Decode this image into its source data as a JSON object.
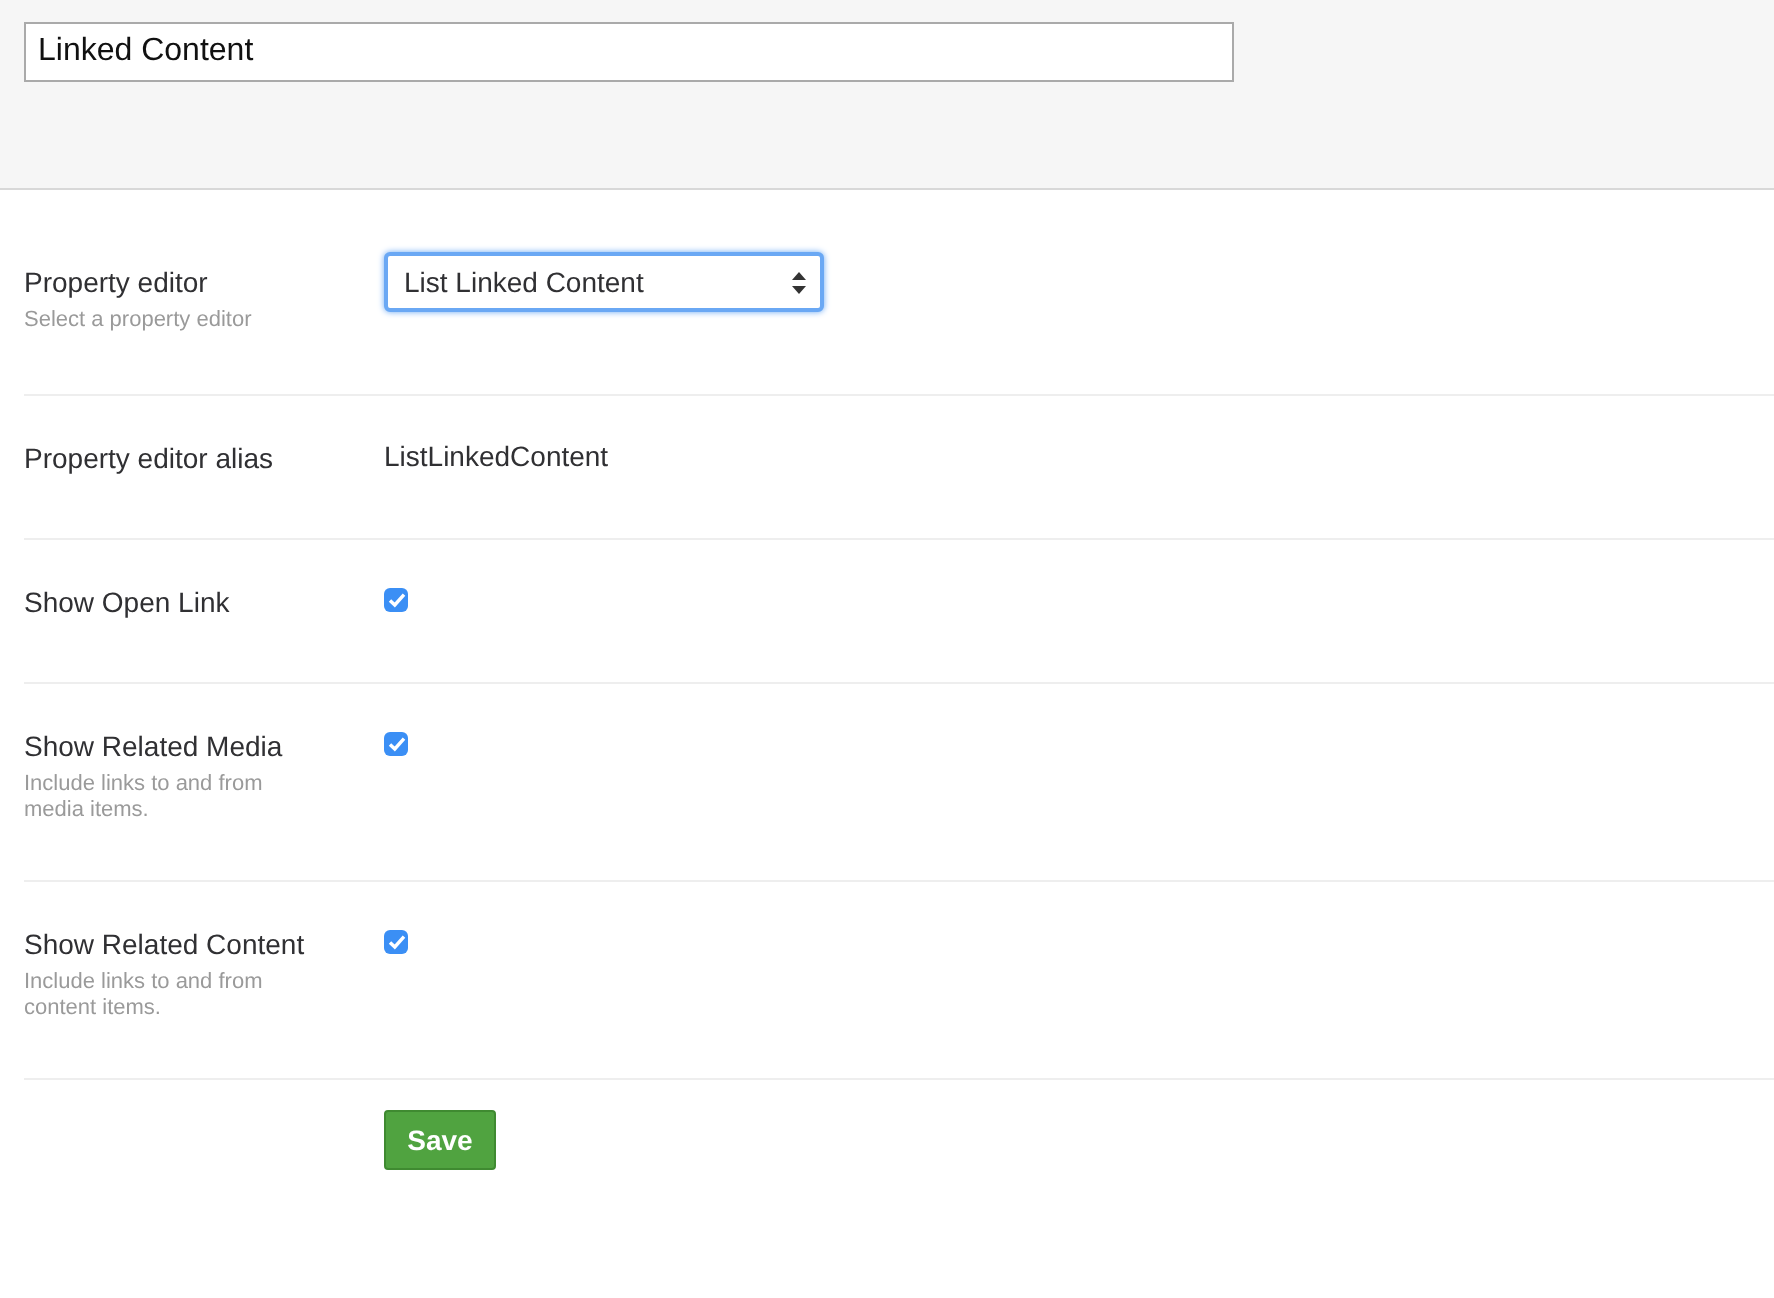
{
  "name_field": {
    "value": "Linked Content"
  },
  "properties": [
    {
      "kind": "select",
      "label": "Property editor",
      "description": "Select a property editor",
      "value": "List Linked Content"
    },
    {
      "kind": "text",
      "label": "Property editor alias",
      "value": "ListLinkedContent"
    },
    {
      "kind": "checkbox",
      "label": "Show Open Link",
      "checked": true
    },
    {
      "kind": "checkbox",
      "label": "Show Related Media",
      "description": "Include links to and from media items.",
      "checked": true
    },
    {
      "kind": "checkbox",
      "label": "Show Related Content",
      "description": "Include links to and from content items.",
      "checked": true
    }
  ],
  "save_button": {
    "label": "Save"
  }
}
